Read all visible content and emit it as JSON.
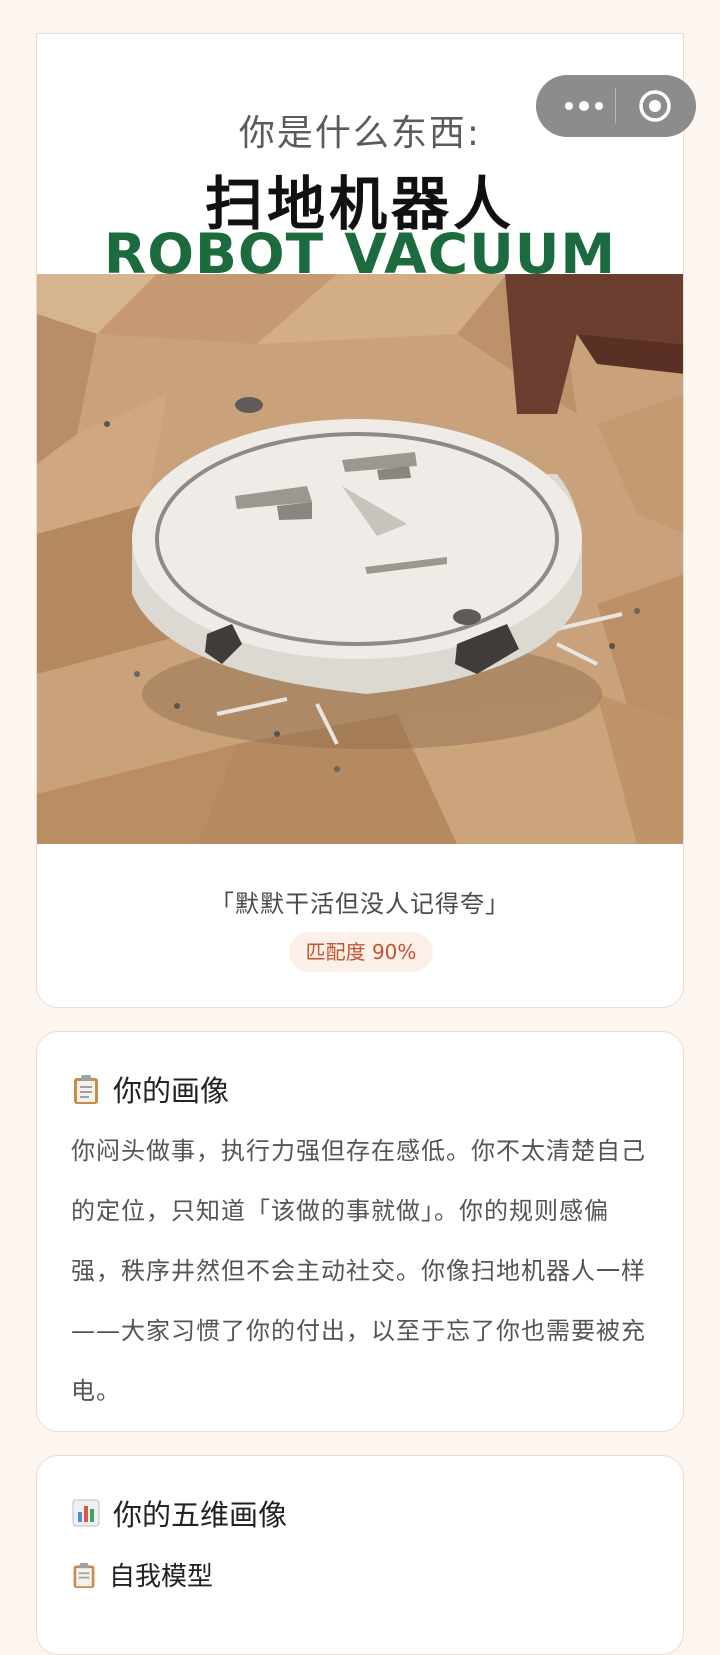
{
  "result": {
    "subtitle": "你是什么东西:",
    "name_cn": "扫地机器人",
    "name_en": "ROBOT VACUUM",
    "quote": "「默默干活但没人记得夸」",
    "match_label": "匹配度 90%",
    "match_percent": 90,
    "accent_color": "#1b6b3e",
    "badge_color": "#c2552d"
  },
  "capsule": {
    "more_icon": "more-dots-icon",
    "close_icon": "target-circle-icon"
  },
  "portrait": {
    "icon": "clipboard-icon",
    "title": "你的画像",
    "text": "你闷头做事，执行力强但存在感低。你不太清楚自己的定位，只知道「该做的事就做」。你的规则感偏强，秩序井然但不会主动社交。你像扫地机器人一样——大家习惯了你的付出，以至于忘了你也需要被充电。"
  },
  "radar": {
    "icon": "bar-chart-icon",
    "title": "你的五维画像",
    "first_dimension": {
      "icon": "clipboard-icon",
      "label": "自我模型"
    }
  }
}
